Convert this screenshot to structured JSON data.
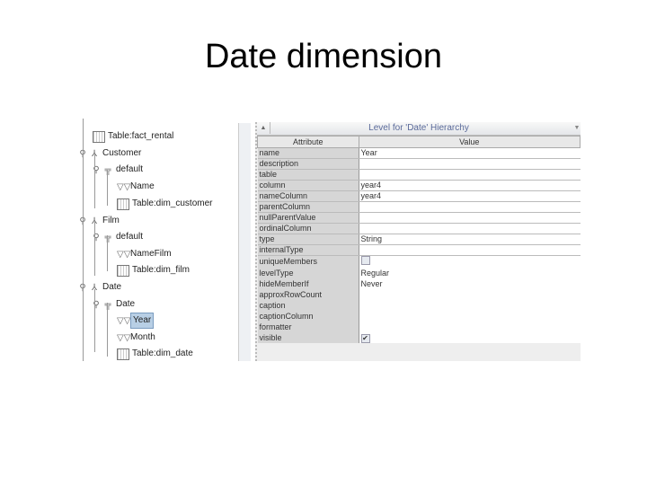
{
  "slide_title": "Date dimension",
  "tree": [
    {
      "label": "Table:fact_rental",
      "icon": "table-icon",
      "level": 1
    },
    {
      "label": "Customer",
      "icon": "dimension-icon",
      "level": 0
    },
    {
      "label": "default",
      "icon": "hierarchy-icon",
      "level": 1
    },
    {
      "label": "Name",
      "icon": "level-icon",
      "level": 2
    },
    {
      "label": "Table:dim_customer",
      "icon": "table-icon",
      "level": 2
    },
    {
      "label": "Film",
      "icon": "dimension-icon",
      "level": 0
    },
    {
      "label": "default",
      "icon": "hierarchy-icon",
      "level": 1
    },
    {
      "label": "NameFilm",
      "icon": "level-icon",
      "level": 2
    },
    {
      "label": "Table:dim_film",
      "icon": "table-icon",
      "level": 2
    },
    {
      "label": "Date",
      "icon": "dimension-icon",
      "level": 0
    },
    {
      "label": "Date",
      "icon": "hierarchy-icon",
      "level": 1
    },
    {
      "label": "Year",
      "icon": "level-icon",
      "level": 2,
      "selected": true
    },
    {
      "label": "Month",
      "icon": "level-icon",
      "level": 2
    },
    {
      "label": "Table:dim_date",
      "icon": "table-icon",
      "level": 2
    }
  ],
  "panel": {
    "title": "Level for 'Date' Hierarchy",
    "col_attribute": "Attribute",
    "col_value": "Value",
    "rows": [
      {
        "a": "name",
        "v": "Year"
      },
      {
        "a": "description",
        "v": ""
      },
      {
        "a": "table",
        "v": ""
      },
      {
        "a": "column",
        "v": "year4"
      },
      {
        "a": "nameColumn",
        "v": "year4"
      },
      {
        "a": "parentColumn",
        "v": ""
      },
      {
        "a": "nullParentValue",
        "v": ""
      },
      {
        "a": "ordinalColumn",
        "v": ""
      },
      {
        "a": "type",
        "v": "String"
      },
      {
        "a": "internalType",
        "v": ""
      },
      {
        "a": "uniqueMembers",
        "v": "",
        "checkbox": false
      },
      {
        "a": "levelType",
        "v": "Regular"
      },
      {
        "a": "hideMemberIf",
        "v": "Never"
      },
      {
        "a": "approxRowCount",
        "v": ""
      },
      {
        "a": "caption",
        "v": ""
      },
      {
        "a": "captionColumn",
        "v": ""
      },
      {
        "a": "formatter",
        "v": ""
      },
      {
        "a": "visible",
        "v": "",
        "checkbox": true
      }
    ]
  }
}
